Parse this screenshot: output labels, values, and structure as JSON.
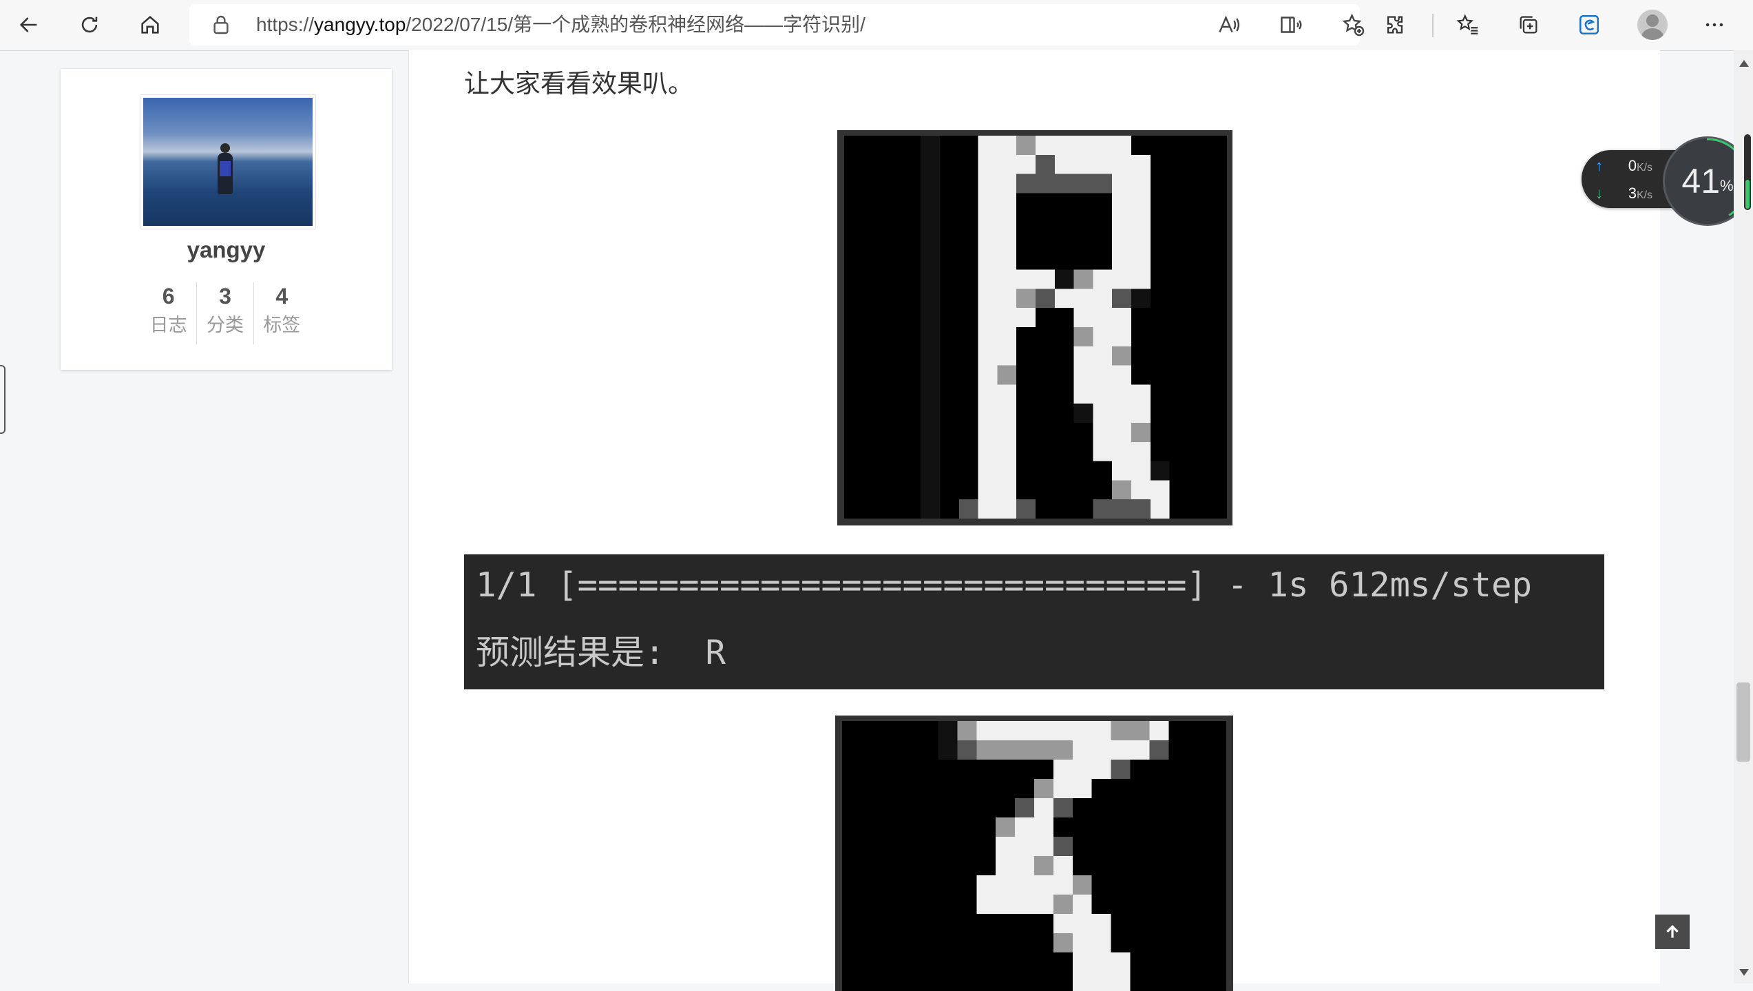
{
  "browser": {
    "url_prefix": "https://",
    "url_host": "yangyy.top",
    "url_path": "/2022/07/15/第一个成熟的卷积神经网络——字符识别/"
  },
  "sidebar": {
    "username": "yangyy",
    "stats": [
      {
        "count": "6",
        "label": "日志"
      },
      {
        "count": "3",
        "label": "分类"
      },
      {
        "count": "4",
        "label": "标签"
      }
    ]
  },
  "post": {
    "intro": "让大家看看效果叭。",
    "code_lines": [
      "1/1 [==============================] - 1s 612ms/step",
      "预测结果是:  R"
    ]
  },
  "net_monitor": {
    "upload": "0",
    "download": "3",
    "unit": "K/s",
    "percent": "41",
    "percent_sign": "%"
  }
}
